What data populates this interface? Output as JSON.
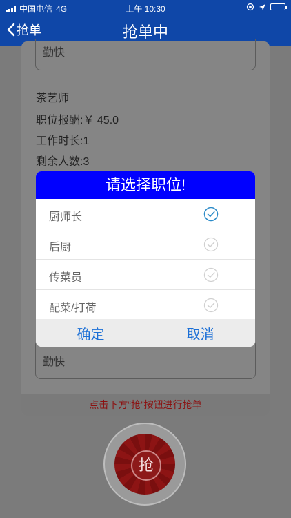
{
  "status_bar": {
    "carrier": "中国电信",
    "network": "4G",
    "time": "上午 10:30"
  },
  "nav": {
    "back_label": "抢单",
    "title": "抢单中"
  },
  "background_card": {
    "top_field_value": "勤快",
    "job_name": "茶艺师",
    "pay": "职位报酬:￥ 45.0",
    "duration": "工作时长:1",
    "remaining": "剩余人数:3",
    "bottom_field_value": "勤快",
    "hint": "点击下方“抢”按钮进行抢单"
  },
  "grab_button": {
    "label": "抢"
  },
  "dialog": {
    "title": "请选择职位!",
    "options": [
      {
        "label": "厨师长",
        "selected": true
      },
      {
        "label": "后厨",
        "selected": false
      },
      {
        "label": "传菜员",
        "selected": false
      },
      {
        "label": "配菜/打荷",
        "selected": false
      }
    ],
    "confirm_label": "确定",
    "cancel_label": "取消"
  },
  "colors": {
    "nav_blue": "#0f47a8",
    "dialog_header": "#0000ff",
    "action_text": "#1b6fd6",
    "check_selected": "#2a8ac8",
    "check_unselected": "#d0d0d0",
    "hint_text": "#8c1010"
  }
}
